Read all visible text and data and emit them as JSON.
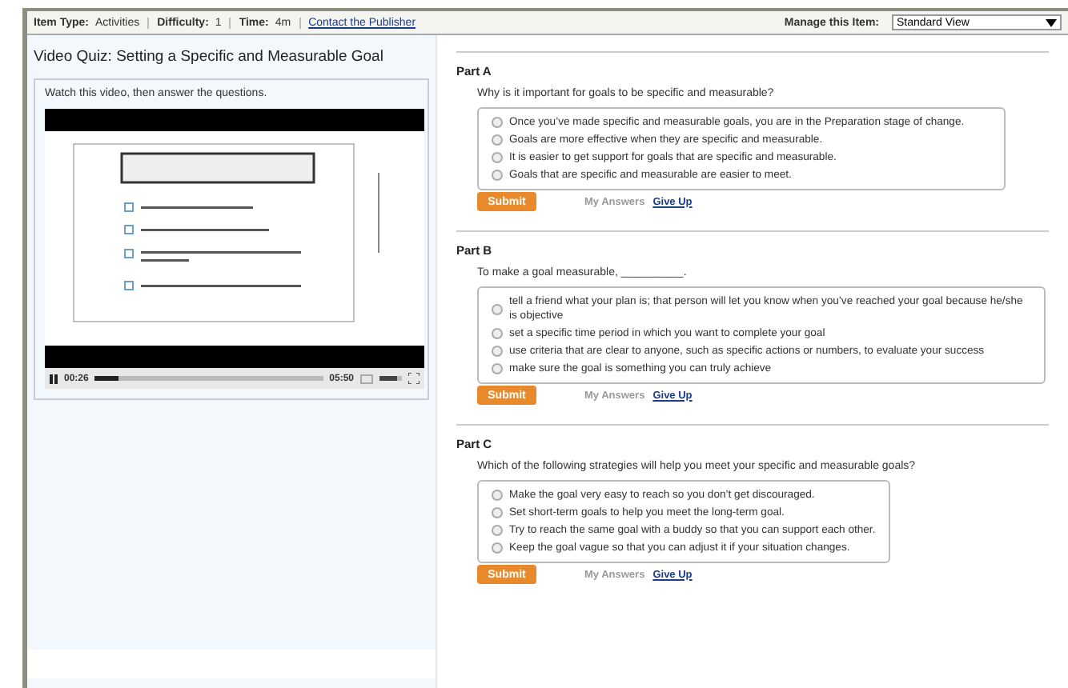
{
  "header": {
    "fields": [
      {
        "label": "Item Type:",
        "value": "Activities"
      },
      {
        "label": "Difficulty:",
        "value": "1"
      },
      {
        "label": "Time:",
        "value": "4m"
      }
    ],
    "link": "Contact the Publisher",
    "manage_label": "Manage this Item:",
    "view_select": {
      "value": "Standard View"
    }
  },
  "left_panel": {
    "title": "Video Quiz: Setting a Specific and Measurable Goal",
    "instructions": "Watch this video, then answer the questions.",
    "video": {
      "current_time": "00:26",
      "duration": "05:50",
      "level": 0.1,
      "volume": {
        "level": 0.8
      }
    }
  },
  "parts": [
    {
      "title": "Part A",
      "question": "Why is it important for goals to be specific and measurable?",
      "options": [
        {
          "text": "Once you’ve made specific and measurable goals, you are in the Preparation stage of change.",
          "selected": false
        },
        {
          "text": "Goals are more effective when they are specific and measurable.",
          "selected": false
        },
        {
          "text": "It is easier to get support for goals that are specific and measurable.",
          "selected": false
        },
        {
          "text": "Goals that are specific and measurable are easier to meet.",
          "selected": false
        }
      ],
      "submit": "Submit",
      "my_answers": "My Answers",
      "give_up": "Give Up"
    },
    {
      "title": "Part B",
      "question": "To make a goal measurable, __________.",
      "options": [
        {
          "text": "tell a friend what your plan is; that person will let you know when you’ve reached your goal because he/she is objective",
          "selected": false
        },
        {
          "text": "set a specific time period in which you want to complete your goal",
          "selected": false
        },
        {
          "text": "use criteria that are clear to anyone, such as specific actions or numbers, to evaluate your success",
          "selected": false
        },
        {
          "text": "make sure the goal is something you can truly achieve",
          "selected": false
        }
      ],
      "submit": "Submit",
      "my_answers": "My Answers",
      "give_up": "Give Up"
    },
    {
      "title": "Part C",
      "question": "Which of the following strategies will help you meet your specific and measurable goals?",
      "options": [
        {
          "text": "Make the goal very easy to reach so you don’t get discouraged.",
          "selected": false
        },
        {
          "text": "Set short-term goals to help you meet the long-term goal.",
          "selected": false
        },
        {
          "text": "Try to reach the same goal with a buddy so that you can support each other.",
          "selected": false
        },
        {
          "text": "Keep the goal vague so that you can adjust it if your situation changes.",
          "selected": false
        }
      ],
      "submit": "Submit",
      "my_answers": "My Answers",
      "give_up": "Give Up"
    }
  ]
}
